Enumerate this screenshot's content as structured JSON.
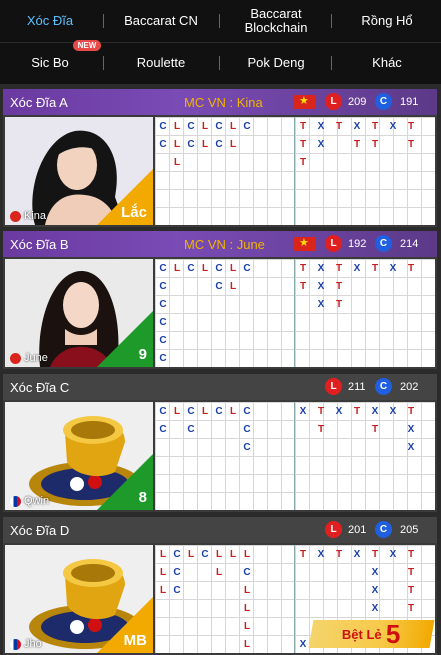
{
  "nav": {
    "row1": [
      "Xóc Đĩa",
      "Baccarat CN",
      "Baccarat Blockchain",
      "Rồng Hổ"
    ],
    "row2": [
      "Sic Bo",
      "Roulette",
      "Pok Deng",
      "Khác"
    ],
    "new_badge": "NEW"
  },
  "rooms": [
    {
      "name": "Xóc Đĩa A",
      "mc": "MC VN : Kina",
      "host": "Kina",
      "l_count": "209",
      "c_count": "191",
      "status": "Lắc",
      "status_color": "#f2a900",
      "head_style": "purple"
    },
    {
      "name": "Xóc Đĩa B",
      "mc": "MC VN : June",
      "host": "June",
      "l_count": "192",
      "c_count": "214",
      "status": "9",
      "status_color": "#1e9a2a",
      "head_style": "purple"
    },
    {
      "name": "Xóc Đĩa C",
      "mc": "",
      "host": "Qwin",
      "l_count": "211",
      "c_count": "202",
      "status": "8",
      "status_color": "#1e9a2a",
      "head_style": "dark"
    },
    {
      "name": "Xóc Đĩa D",
      "mc": "",
      "host": "Jho",
      "l_count": "201",
      "c_count": "205",
      "status": "MB",
      "status_color": "#f2a900",
      "head_style": "dark"
    }
  ],
  "badges": {
    "l": "L",
    "c": "C"
  },
  "bet_banner": {
    "label": "Bệt Lẻ",
    "number": "5"
  },
  "beads": [
    {
      "left": [
        [
          "C",
          0,
          0
        ],
        [
          "L",
          1,
          0
        ],
        [
          "C",
          2,
          0
        ],
        [
          "L",
          3,
          0
        ],
        [
          "C",
          4,
          0
        ],
        [
          "L",
          5,
          0
        ],
        [
          "C",
          6,
          0
        ],
        [
          "C",
          0,
          1
        ],
        [
          "L",
          1,
          1
        ],
        [
          "C",
          2,
          1
        ],
        [
          "L",
          3,
          1
        ],
        [
          "C",
          4,
          1
        ],
        [
          "L",
          5,
          1
        ],
        [
          "L",
          1,
          2
        ]
      ],
      "right": [
        [
          "T",
          0,
          0
        ],
        [
          "X",
          1,
          0
        ],
        [
          "T",
          2,
          0
        ],
        [
          "X",
          3,
          0
        ],
        [
          "T",
          4,
          0
        ],
        [
          "X",
          5,
          0
        ],
        [
          "T",
          6,
          0
        ],
        [
          "T",
          0,
          1
        ],
        [
          "X",
          1,
          1
        ],
        [
          "T",
          3,
          1
        ],
        [
          "T",
          4,
          1
        ],
        [
          "T",
          6,
          1
        ],
        [
          "T",
          0,
          2
        ]
      ]
    },
    {
      "left": [
        [
          "C",
          0,
          0
        ],
        [
          "L",
          1,
          0
        ],
        [
          "C",
          2,
          0
        ],
        [
          "L",
          3,
          0
        ],
        [
          "C",
          4,
          0
        ],
        [
          "L",
          5,
          0
        ],
        [
          "C",
          6,
          0
        ],
        [
          "C",
          0,
          1
        ],
        [
          "C",
          4,
          1
        ],
        [
          "L",
          5,
          1
        ],
        [
          "C",
          0,
          2
        ],
        [
          "C",
          0,
          3
        ],
        [
          "C",
          0,
          4
        ],
        [
          "C",
          0,
          5
        ]
      ],
      "right": [
        [
          "T",
          0,
          0
        ],
        [
          "X",
          1,
          0
        ],
        [
          "T",
          2,
          0
        ],
        [
          "X",
          3,
          0
        ],
        [
          "T",
          4,
          0
        ],
        [
          "X",
          5,
          0
        ],
        [
          "T",
          6,
          0
        ],
        [
          "T",
          0,
          1
        ],
        [
          "X",
          1,
          1
        ],
        [
          "T",
          2,
          1
        ],
        [
          "X",
          1,
          2
        ],
        [
          "T",
          2,
          2
        ]
      ]
    },
    {
      "left": [
        [
          "C",
          0,
          0
        ],
        [
          "L",
          1,
          0
        ],
        [
          "C",
          2,
          0
        ],
        [
          "L",
          3,
          0
        ],
        [
          "C",
          4,
          0
        ],
        [
          "L",
          5,
          0
        ],
        [
          "C",
          6,
          0
        ],
        [
          "C",
          0,
          1
        ],
        [
          "C",
          2,
          1
        ],
        [
          "C",
          6,
          1
        ],
        [
          "C",
          6,
          2
        ]
      ],
      "right": [
        [
          "X",
          0,
          0
        ],
        [
          "T",
          1,
          0
        ],
        [
          "X",
          2,
          0
        ],
        [
          "T",
          3,
          0
        ],
        [
          "X",
          4,
          0
        ],
        [
          "X",
          5,
          0
        ],
        [
          "T",
          6,
          0
        ],
        [
          "T",
          1,
          1
        ],
        [
          "T",
          4,
          1
        ],
        [
          "X",
          6,
          1
        ],
        [
          "X",
          6,
          2
        ]
      ]
    },
    {
      "left": [
        [
          "L",
          0,
          0
        ],
        [
          "C",
          1,
          0
        ],
        [
          "L",
          2,
          0
        ],
        [
          "C",
          3,
          0
        ],
        [
          "L",
          4,
          0
        ],
        [
          "L",
          5,
          0
        ],
        [
          "L",
          6,
          0
        ],
        [
          "L",
          0,
          1
        ],
        [
          "C",
          1,
          1
        ],
        [
          "L",
          4,
          1
        ],
        [
          "C",
          6,
          1
        ],
        [
          "L",
          0,
          2
        ],
        [
          "C",
          1,
          2
        ],
        [
          "L",
          6,
          2
        ],
        [
          "L",
          6,
          3
        ],
        [
          "L",
          6,
          4
        ],
        [
          "L",
          6,
          5
        ]
      ],
      "right": [
        [
          "T",
          0,
          0
        ],
        [
          "X",
          1,
          0
        ],
        [
          "T",
          2,
          0
        ],
        [
          "X",
          3,
          0
        ],
        [
          "T",
          4,
          0
        ],
        [
          "X",
          5,
          0
        ],
        [
          "T",
          6,
          0
        ],
        [
          "X",
          4,
          1
        ],
        [
          "T",
          6,
          1
        ],
        [
          "X",
          4,
          2
        ],
        [
          "T",
          6,
          2
        ],
        [
          "X",
          4,
          3
        ],
        [
          "T",
          6,
          3
        ],
        [
          "X",
          4,
          4
        ],
        [
          "T",
          6,
          4
        ],
        [
          "X",
          0,
          5
        ]
      ]
    }
  ]
}
